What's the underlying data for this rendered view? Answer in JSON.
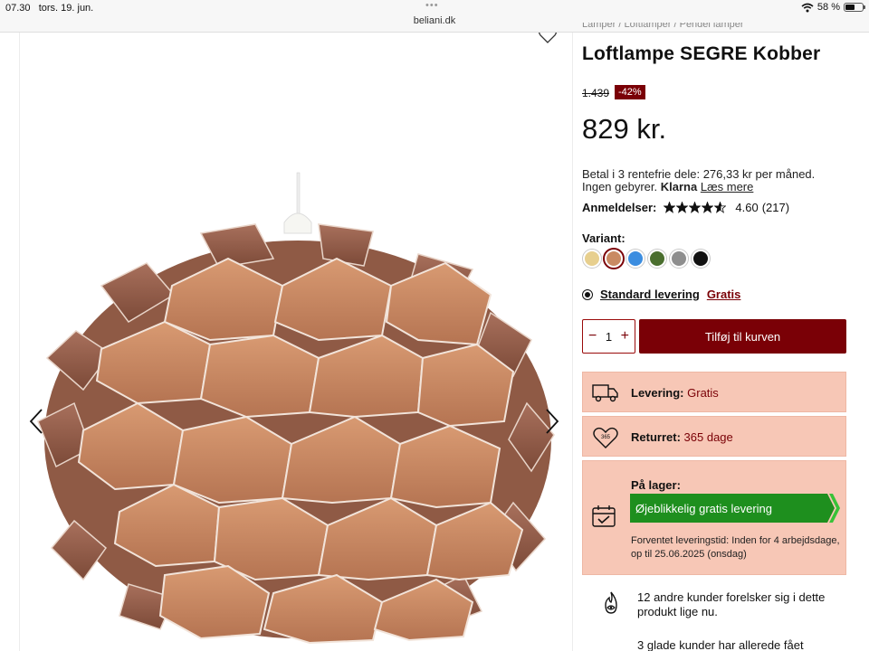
{
  "status_bar": {
    "time": "07.30",
    "date": "tors. 19. jun.",
    "url": "beliani.dk",
    "battery": "58 %",
    "battery_level": 0.58
  },
  "breadcrumb": "Lamper / Loftlamper / Pendel lamper",
  "product": {
    "title": "Loftlampe SEGRE Kobber",
    "old_price": "1.439",
    "discount": "-42%",
    "price": "829 kr.",
    "klarna_line1": "Betal i 3 rentefrie dele: 276,33 kr per måned.",
    "klarna_line2": "Ingen gebyrer.",
    "klarna_brand": "Klarna",
    "klarna_link": "Læs mere",
    "reviews_label": "Anmeldelser:",
    "rating": "4.60",
    "rating_value": 4.6,
    "review_count": "(217)",
    "variant_label": "Variant:",
    "variants": [
      {
        "color": "#e7cf8e",
        "selected": false
      },
      {
        "color": "#c98a63",
        "selected": true
      },
      {
        "color": "#3b8de0",
        "selected": false
      },
      {
        "color": "#4a6e2e",
        "selected": false
      },
      {
        "color": "#8e8e8e",
        "selected": false
      },
      {
        "color": "#111111",
        "selected": false
      }
    ],
    "delivery_option": "Standard levering",
    "delivery_price": "Gratis",
    "quantity": "1",
    "add_to_cart": "Tilføj til kurven"
  },
  "info_boxes": {
    "delivery_label": "Levering:",
    "delivery_value": "Gratis",
    "return_label": "Returret:",
    "return_value": "365 dage",
    "return_icon_text": "365",
    "stock_label": "På lager:",
    "stock_banner": "Øjeblikkelig gratis levering",
    "eta_text": "Forventet leveringstid: Inden for 4 arbejdsdage, op til 25.06.2025 (onsdag)"
  },
  "social_proof": {
    "loves": "12 andre kunder forelsker sig i dette produkt lige nu.",
    "bought": "3 glade kunder har allerede fået"
  },
  "colors": {
    "accent": "#7a0006",
    "info_bg": "#f7c7b6",
    "stock_green": "#1e8f1e"
  },
  "icons": [
    "heart-icon",
    "chevron-left-icon",
    "chevron-right-icon",
    "truck-icon",
    "return-365-icon",
    "calendar-check-icon",
    "fire-icon",
    "wifi-icon",
    "battery-icon"
  ]
}
